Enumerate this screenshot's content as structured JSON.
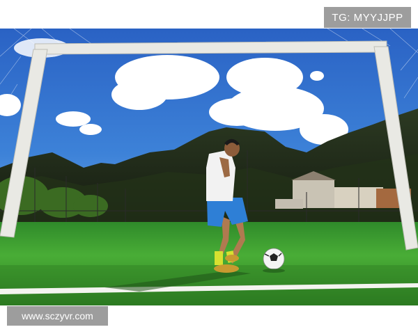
{
  "watermark_top": "TG: MYYJJPP",
  "watermark_bottom": "www.sczyvr.com",
  "colors": {
    "sky_top": "#2f6fd0",
    "sky_bottom": "#6fa8ec",
    "grass": "#3fa12e",
    "mountain": "#1f2a18",
    "goal_post": "#e9e9e4",
    "jersey": "#f2f2f2",
    "shorts": "#2e7fd6",
    "watermark_bg": "#9d9d9d"
  },
  "scene": {
    "subject": "soccer player dribbling ball in front of goal",
    "objects": [
      "goal-frame",
      "goal-net",
      "mountains",
      "clouds",
      "artificial-turf",
      "soccer-ball",
      "player",
      "fence",
      "buildings"
    ]
  }
}
